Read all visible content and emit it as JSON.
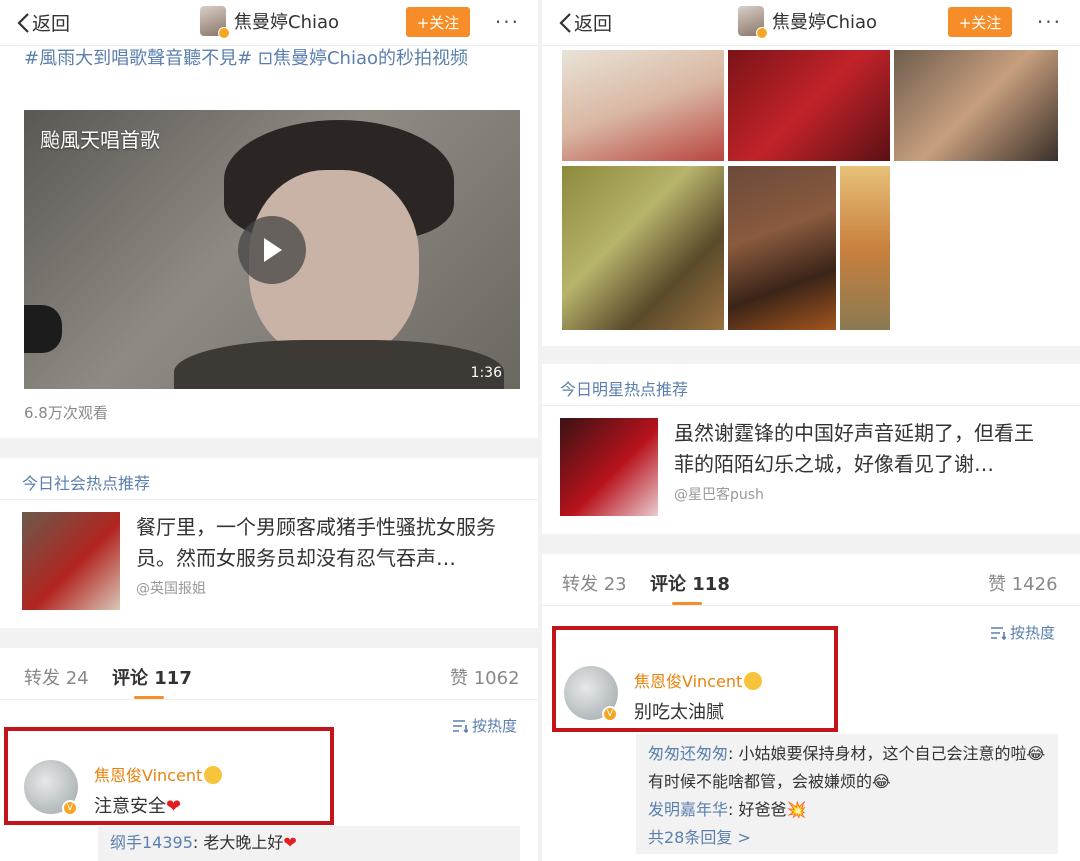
{
  "left": {
    "nav": {
      "back": "返回",
      "title": "焦曼婷Chiao",
      "follow": "+关注",
      "more": "···"
    },
    "tag_line": "#風雨大到唱歌聲音聽不見# ⊡焦曼婷Chiao的秒拍视频",
    "video": {
      "title": "颱風天唱首歌",
      "duration": "1:36"
    },
    "views": "6.8万次观看",
    "hot_label": "今日社会热点推荐",
    "news": {
      "text": "餐厅里，一个男顾客咸猪手性骚扰女服务员。然而女服务员却没有忍气吞声…",
      "source": "@英国报姐"
    },
    "tabs": {
      "repost": "转发 24",
      "comment": "评论 117",
      "like": "赞 1062"
    },
    "sort": "按热度",
    "comment": {
      "name": "焦恩俊Vincent",
      "text": "注意安全",
      "heart": "❤"
    },
    "reply": {
      "name": "纲手14395",
      "text": "老大晚上好",
      "heart": "❤"
    }
  },
  "right": {
    "nav": {
      "back": "返回",
      "title": "焦曼婷Chiao",
      "follow": "+关注",
      "more": "···"
    },
    "hot_label": "今日明星热点推荐",
    "news": {
      "text": "虽然谢霆锋的中国好声音延期了，但看王菲的陌陌幻乐之城，好像看见了谢…",
      "source": "@星巴客push"
    },
    "tabs": {
      "repost": "转发 23",
      "comment": "评论 118",
      "like": "赞 1426"
    },
    "sort": "按热度",
    "comment": {
      "name": "焦恩俊Vincent",
      "text": "别吃太油腻"
    },
    "replies": [
      {
        "name": "匆匆还匆匆",
        "text": "小姑娘要保持身材，这个自己会注意的啦😂有时候不能啥都管，会被嫌烦的😂"
      },
      {
        "name": "发明嘉年华",
        "text": "好爸爸💥"
      }
    ],
    "replies_more": "共28条回复 >"
  },
  "colors": {
    "accent": "#f78d28",
    "link": "#5b7fae",
    "highlight_box": "#c4141b",
    "name": "#e8830e"
  }
}
